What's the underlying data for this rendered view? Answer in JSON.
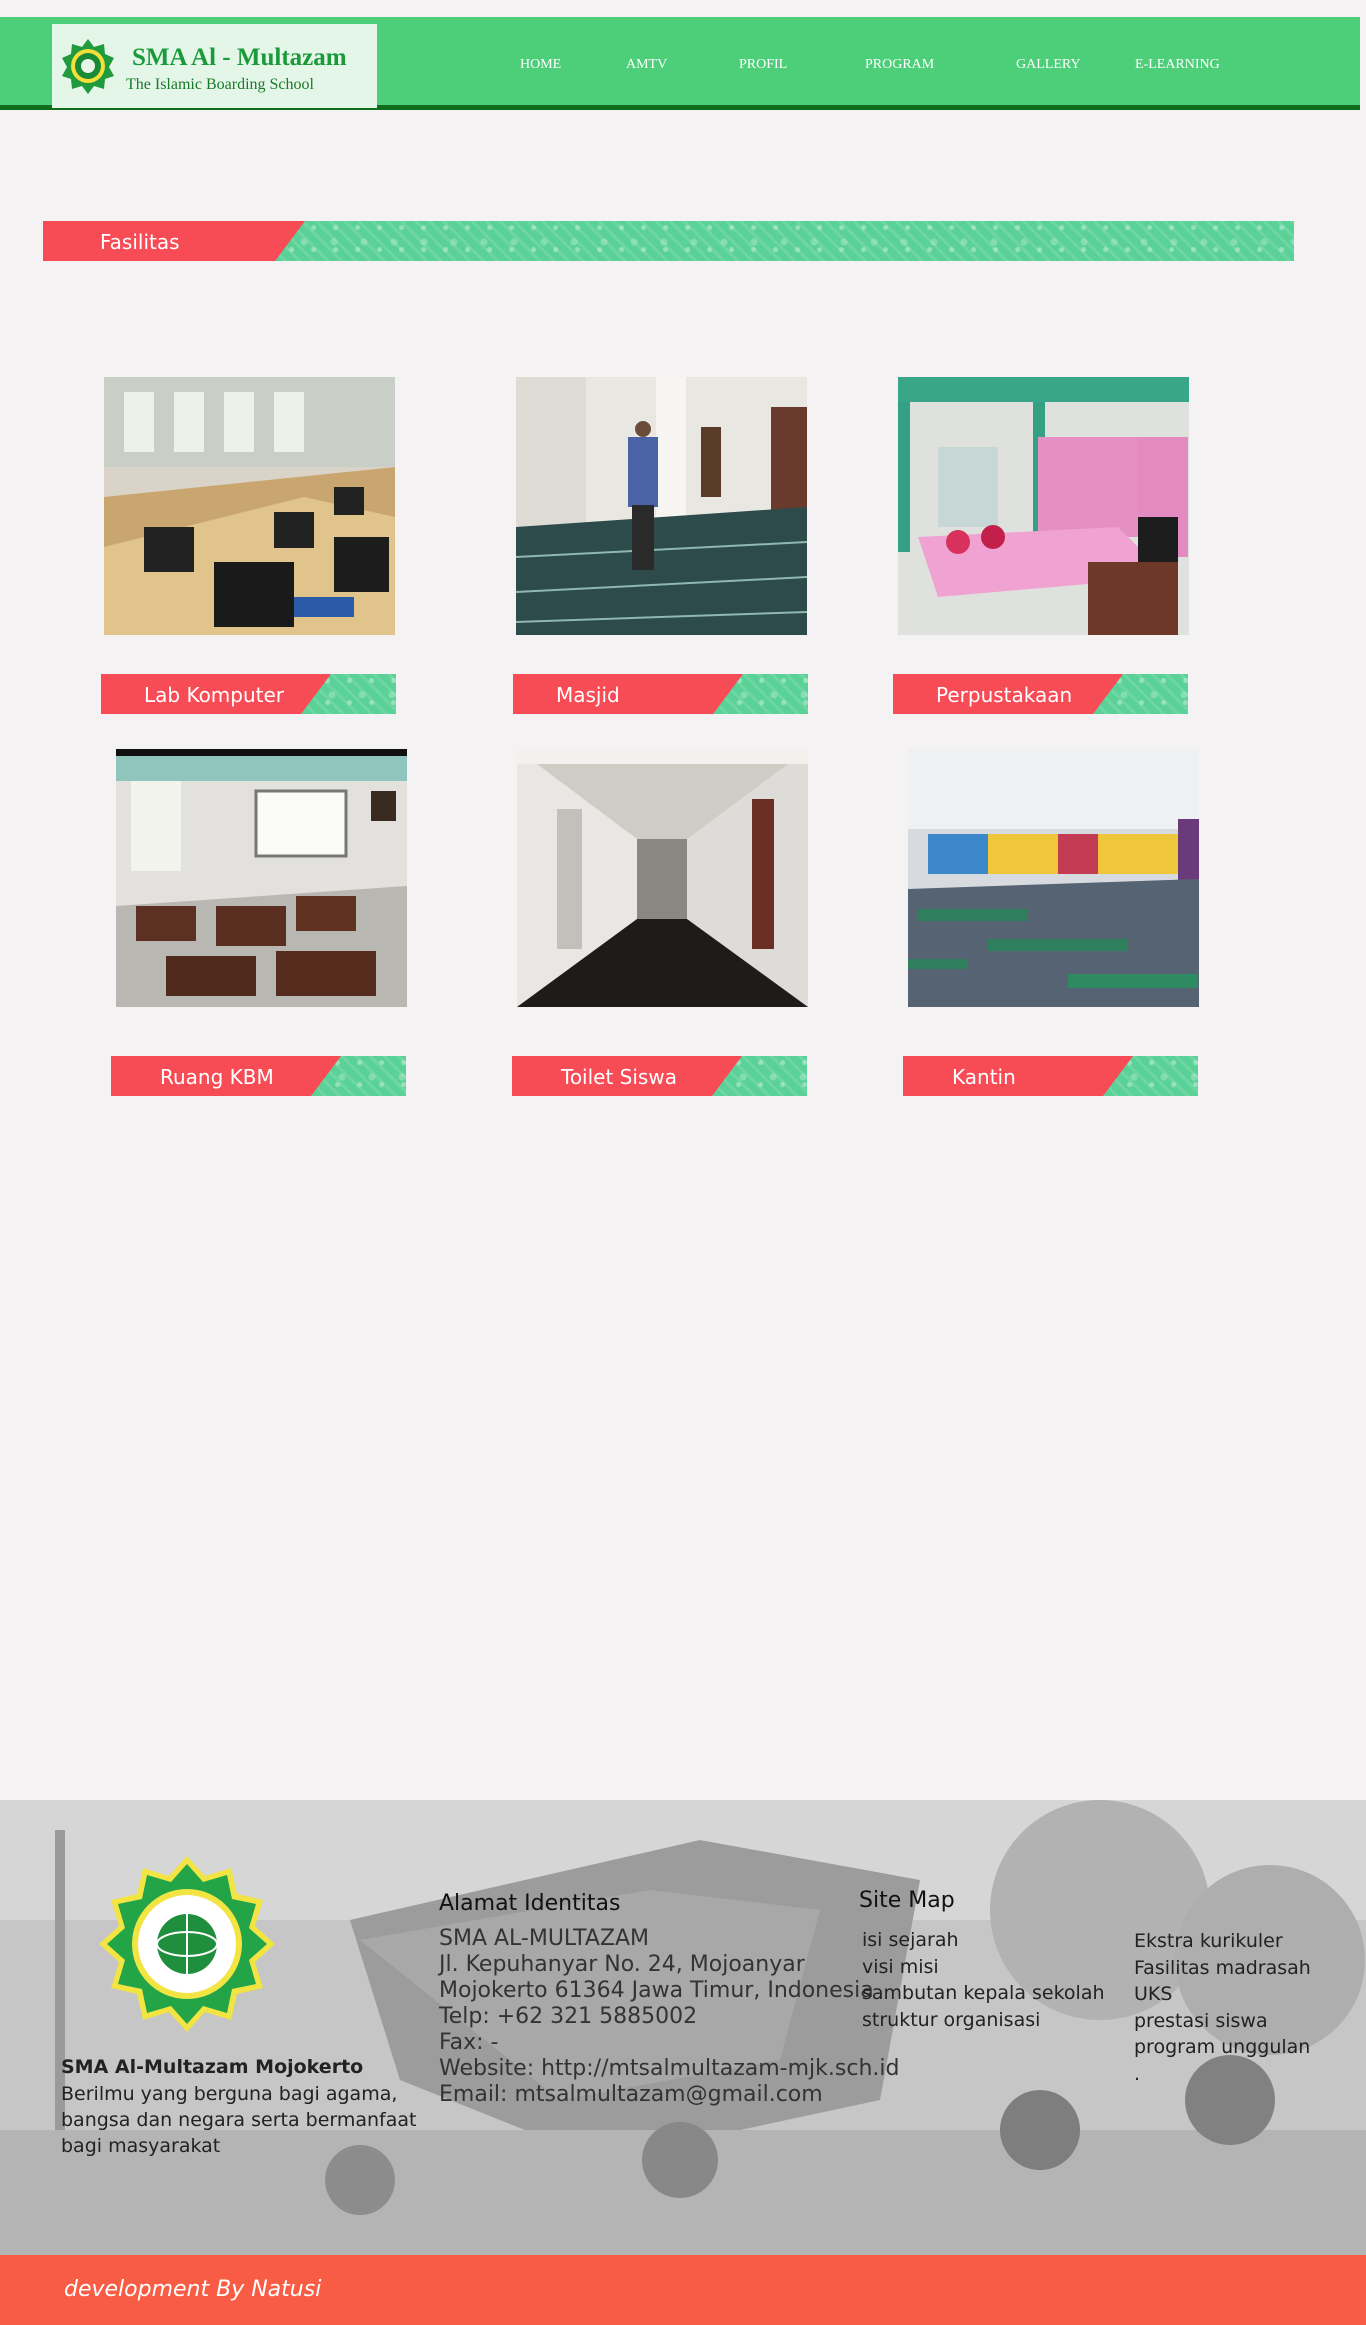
{
  "header": {
    "logo_title": "SMA Al - Multazam",
    "logo_subtitle": "The Islamic Boarding School",
    "nav": [
      "HOME",
      "AMTV",
      "PROFIL",
      "PROGRAM",
      "GALLERY",
      "E-LEARNING"
    ]
  },
  "section": {
    "title": "Fasilitas"
  },
  "facilities": [
    {
      "label": "Lab Komputer",
      "photo": "computer-lab"
    },
    {
      "label": "Masjid",
      "photo": "mosque-interior"
    },
    {
      "label": "Perpustakaan",
      "photo": "library"
    },
    {
      "label": "Ruang KBM",
      "photo": "classroom"
    },
    {
      "label": "Toilet Siswa",
      "photo": "toilet-corridor"
    },
    {
      "label": "Kantin",
      "photo": "canteen"
    }
  ],
  "footer": {
    "school_name": "SMA Al-Multazam Mojokerto",
    "motto": "Berilmu yang berguna bagi agama, bangsa dan negara serta bermanfaat bagi masyarakat",
    "address_heading": "Alamat Identitas",
    "address_lines": [
      "SMA AL-MULTAZAM",
      "Jl. Kepuhanyar No. 24, Mojoanyar",
      "Mojokerto 61364 Jawa Timur, Indonesia",
      "Telp: +62 321 5885002",
      "Fax: -",
      "Website: http://mtsalmultazam-mjk.sch.id",
      "Email: mtsalmultazam@gmail.com"
    ],
    "sitemap_heading": "Site Map",
    "sitemap_col1": [
      "isi sejarah",
      "visi misi",
      "sambutan kepala sekolah",
      "struktur organisasi"
    ],
    "sitemap_col2": [
      "Ekstra kurikuler",
      "Fasilitas madrasah",
      "UKS",
      "prestasi siswa",
      "program unggulan",
      "."
    ],
    "credit": "development By Natusi"
  },
  "colors": {
    "header_green": "#4dce79",
    "banner_red": "#f74b56",
    "banner_pattern": "#5ad197",
    "footer_bar": "#f85c44"
  }
}
